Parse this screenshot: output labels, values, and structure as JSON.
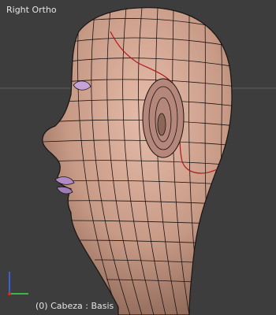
{
  "viewport": {
    "view_label": "Right Ortho",
    "object_info": "(0) Cabeza : Basis"
  },
  "colors": {
    "background": "#3d3d3d",
    "skin": "#c79a86",
    "skin_shadow": "#8c6656",
    "wire": "#1a1412",
    "seam": "#b01818",
    "lips": "#b08ac4",
    "x_axis": "#cc2e2e",
    "y_axis": "#3fb83f",
    "z_axis": "#3a5fd8"
  },
  "icons": [
    "axis-gizmo-icon"
  ]
}
